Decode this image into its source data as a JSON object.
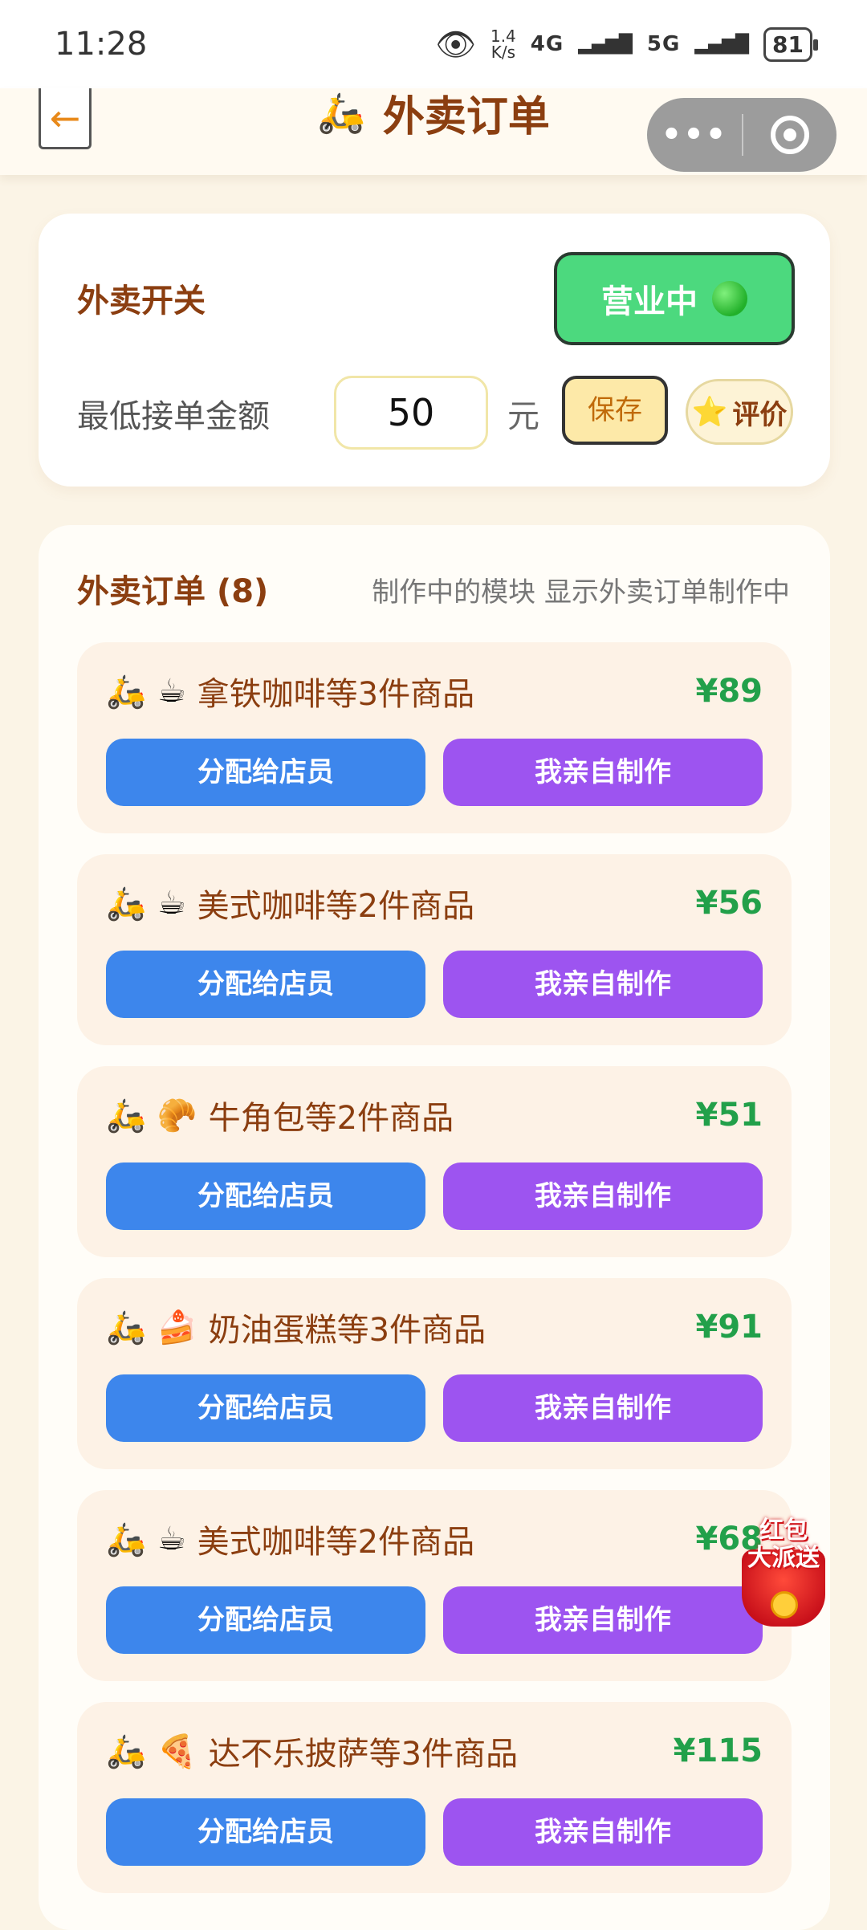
{
  "status_bar": {
    "time": "11:28",
    "rate_value": "1.4",
    "rate_unit": "K/s",
    "net1": "4G",
    "net2": "5G",
    "battery": "81"
  },
  "header": {
    "back_icon": "←",
    "scooter_icon": "🛵",
    "title": "外卖订单",
    "more_icon": "•••"
  },
  "switch": {
    "label": "外卖开关",
    "status": "营业中",
    "min_label": "最低接单金额",
    "min_value": "50",
    "unit": "元",
    "save": "保存",
    "review": "评价",
    "review_icon": "⭐"
  },
  "orders": {
    "title": "外卖订单 (8)",
    "note": "制作中的模块 显示外卖订单制作中",
    "assign_label": "分配给店员",
    "self_label": "我亲自制作",
    "items": [
      {
        "icon": "☕",
        "name": "拿铁咖啡等3件商品",
        "price": "¥89"
      },
      {
        "icon": "☕",
        "name": "美式咖啡等2件商品",
        "price": "¥56"
      },
      {
        "icon": "🥐",
        "name": "牛角包等2件商品",
        "price": "¥51"
      },
      {
        "icon": "🍰",
        "name": "奶油蛋糕等3件商品",
        "price": "¥91"
      },
      {
        "icon": "☕",
        "name": "美式咖啡等2件商品",
        "price": "¥68"
      },
      {
        "icon": "🍕",
        "name": "达不乐披萨等3件商品",
        "price": "¥115"
      }
    ]
  },
  "red_packet": {
    "line1": "红包",
    "line2": "大派送"
  },
  "colors": {
    "accent_brown": "#8b3e10",
    "price_green": "#22a04a",
    "assign_blue": "#3d86ec",
    "self_purple": "#9d54f0",
    "open_green": "#4cd97e"
  }
}
